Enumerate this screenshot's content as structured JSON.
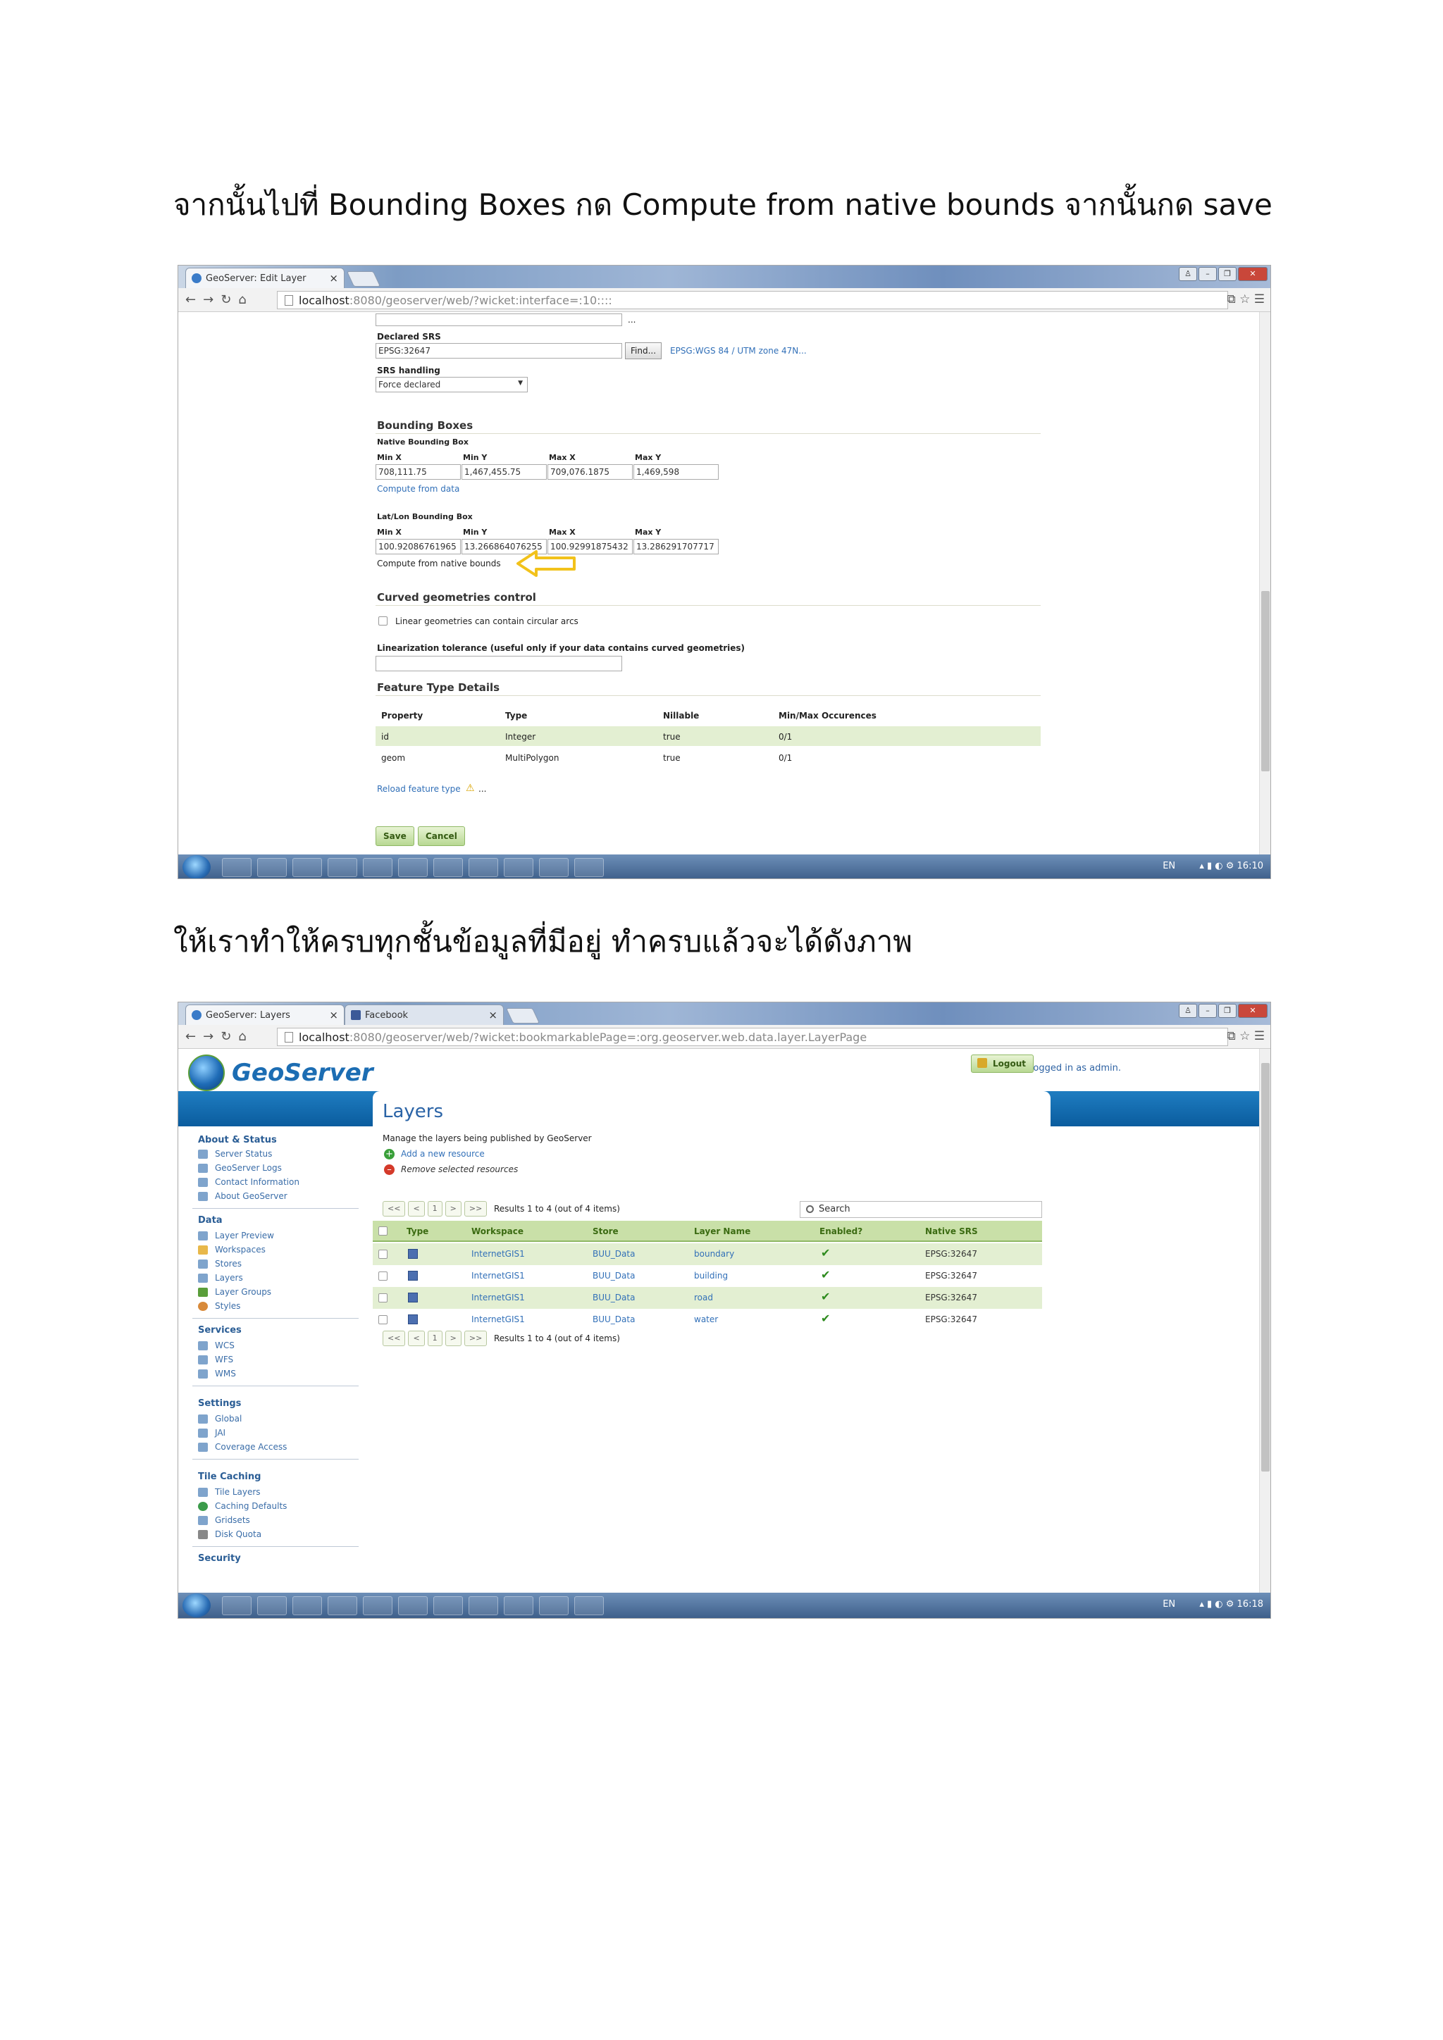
{
  "step1_caption": "จากนั้นไปที่ Bounding Boxes  กด Compute from native bounds  จากนั้นกด save",
  "step2_caption": "ให้เราทำให้ครบทุกชั้นข้อมูลที่มีอยู่ ทำครบแล้วจะได้ดังภาพ",
  "shot1": {
    "tab_title": "GeoServer: Edit Layer",
    "url_host": "localhost",
    "url_path": ":8080/geoserver/web/?wicket:interface=:10::::",
    "ellipsis": "...",
    "declared_srs_label": "Declared SRS",
    "declared_srs_value": "EPSG:32647",
    "find_button": "Find...",
    "srs_link": "EPSG:WGS 84 / UTM zone 47N...",
    "srs_handling_label": "SRS handling",
    "srs_handling_value": "Force declared",
    "bounding_boxes_title": "Bounding Boxes",
    "native_bbox_label": "Native Bounding Box",
    "col_minx": "Min X",
    "col_miny": "Min Y",
    "col_maxx": "Max X",
    "col_maxy": "Max Y",
    "native": {
      "minx": "708,111.75",
      "miny": "1,467,455.75",
      "maxx": "709,076.1875",
      "maxy": "1,469,598"
    },
    "compute_from_data": "Compute from data",
    "latlon_bbox_label": "Lat/Lon Bounding Box",
    "latlon": {
      "minx": "100.92086761965",
      "miny": "13.266864076255",
      "maxx": "100.92991875432",
      "maxy": "13.286291707717"
    },
    "compute_from_native": "Compute from native bounds",
    "curved_title": "Curved geometries control",
    "curved_checkbox": "Linear geometries can contain circular arcs",
    "linearization_label": "Linearization tolerance (useful only if your data contains curved geometries)",
    "ftd_title": "Feature Type Details",
    "ftd_cols": [
      "Property",
      "Type",
      "Nillable",
      "Min/Max Occurences"
    ],
    "ftd_rows": [
      [
        "id",
        "Integer",
        "true",
        "0/1"
      ],
      [
        "geom",
        "MultiPolygon",
        "true",
        "0/1"
      ]
    ],
    "reload_link": "Reload feature type",
    "reload_suffix": "...",
    "save": "Save",
    "cancel": "Cancel",
    "tray_lang": "EN",
    "tray_time": "16:10",
    "arrow_color": "#f2c21b"
  },
  "shot2": {
    "tab1_title": "GeoServer: Layers",
    "tab2_title": "Facebook",
    "url_host": "localhost",
    "url_path": ":8080/geoserver/web/?wicket:bookmarkablePage=:org.geoserver.web.data.layer.LayerPage",
    "logo_text": "GeoServer",
    "logged_in": "Logged in as admin.",
    "logout": "Logout",
    "sidebar": {
      "about": "About & Status",
      "about_items": [
        "Server Status",
        "GeoServer Logs",
        "Contact Information",
        "About GeoServer"
      ],
      "data": "Data",
      "data_items": [
        "Layer Preview",
        "Workspaces",
        "Stores",
        "Layers",
        "Layer Groups",
        "Styles"
      ],
      "services": "Services",
      "services_items": [
        "WCS",
        "WFS",
        "WMS"
      ],
      "settings": "Settings",
      "settings_items": [
        "Global",
        "JAI",
        "Coverage Access"
      ],
      "tile": "Tile Caching",
      "tile_items": [
        "Tile Layers",
        "Caching Defaults",
        "Gridsets",
        "Disk Quota"
      ],
      "security": "Security"
    },
    "page_title": "Layers",
    "page_desc": "Manage the layers being published by GeoServer",
    "add_resource": "Add a new resource",
    "remove_resources": "Remove selected resources",
    "pager": [
      "<<",
      "<",
      "1",
      ">",
      ">>"
    ],
    "results": "Results 1 to 4 (out of 4 items)",
    "search_placeholder": "Search",
    "cols": [
      "Type",
      "Workspace",
      "Store",
      "Layer Name",
      "Enabled?",
      "Native SRS"
    ],
    "rows": [
      {
        "workspace": "InternetGIS1",
        "store": "BUU_Data",
        "layer": "boundary",
        "srs": "EPSG:32647",
        "shaded": true
      },
      {
        "workspace": "InternetGIS1",
        "store": "BUU_Data",
        "layer": "building",
        "srs": "EPSG:32647",
        "shaded": false
      },
      {
        "workspace": "InternetGIS1",
        "store": "BUU_Data",
        "layer": "road",
        "srs": "EPSG:32647",
        "shaded": true
      },
      {
        "workspace": "InternetGIS1",
        "store": "BUU_Data",
        "layer": "water",
        "srs": "EPSG:32647",
        "shaded": false
      }
    ],
    "tray_lang": "EN",
    "tray_time": "16:18"
  }
}
